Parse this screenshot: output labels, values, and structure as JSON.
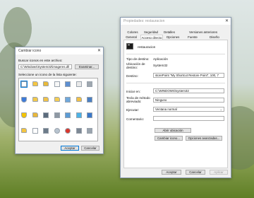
{
  "icon_dialog": {
    "title": "Cambiar icono",
    "search_label": "Buscar iconos en este archivo:",
    "file_path": "C:\\Windows\\System32\\imageres.dll",
    "browse_button": "Examinar...",
    "select_label": "Seleccione un icono de la lista siguiente:",
    "ok_button": "Aceptar",
    "cancel_button": "Cancelar",
    "icons": [
      {
        "name": "blank-page-icon",
        "color": "#ffffff"
      },
      {
        "name": "folder-icon",
        "color": "#f4c542"
      },
      {
        "name": "folder-icon",
        "color": "#e8b93a"
      },
      {
        "name": "document-icon",
        "color": "#f7f7f7"
      },
      {
        "name": "monitor-icon",
        "color": "#5d8fd1"
      },
      {
        "name": "document-icon",
        "color": "#e9e9e9"
      },
      {
        "name": "drive-icon",
        "color": "#a0a8b0"
      },
      {
        "name": "shield-icon",
        "color": "#3d7bd9"
      },
      {
        "name": "folder-icon",
        "color": "#f2c94c"
      },
      {
        "name": "folder-icon",
        "color": "#f0c24a"
      },
      {
        "name": "folder-icon",
        "color": "#f4cd55"
      },
      {
        "name": "image-icon",
        "color": "#6fa8dc"
      },
      {
        "name": "folder-icon",
        "color": "#f0c048"
      },
      {
        "name": "monitor-icon",
        "color": "#4a7fc2"
      },
      {
        "name": "shield-icon",
        "color": "#f5c400"
      },
      {
        "name": "folder-icon",
        "color": "#e9b73a"
      },
      {
        "name": "device-icon",
        "color": "#5b6b7c"
      },
      {
        "name": "drive-icon",
        "color": "#8e98a3"
      },
      {
        "name": "network-drive-icon",
        "color": "#5b9bd5"
      },
      {
        "name": "music-icon",
        "color": "#4db3e6"
      },
      {
        "name": "monitor-icon",
        "color": "#3a78c9"
      },
      {
        "name": "folder-icon",
        "color": "#f4c542"
      },
      {
        "name": "document-icon",
        "color": "#ffffff"
      },
      {
        "name": "device-icon",
        "color": "#6d7b89"
      },
      {
        "name": "disc-icon",
        "color": "#b8c4cf"
      },
      {
        "name": "error-icon",
        "color": "#d9362c"
      },
      {
        "name": "drive-icon",
        "color": "#7d8894"
      },
      {
        "name": "drive-icon",
        "color": "#9aa4ae"
      }
    ]
  },
  "props_dialog": {
    "title": "Propiedades: restauracion",
    "tabs_row1": [
      "Colores",
      "Seguridad",
      "Detalles",
      "Versiones anteriores"
    ],
    "tabs_row2": [
      "General",
      "Acceso directo",
      "Opciones",
      "Fuente",
      "Diseño"
    ],
    "shortcut_name": "restauracion",
    "target_type_label": "Tipo de destino:",
    "target_type_value": "Aplicación",
    "target_location_label": "Ubicación de destino:",
    "target_location_value": "System32",
    "target_label": "Destino:",
    "target_value": "storePoint \"My Shortcut Restore Point\", 100, 7",
    "start_in_label": "Iniciar en:",
    "start_in_value": "C:\\WINDOWS\\system32",
    "hotkey_label": "Tecla de método abreviado:",
    "hotkey_value": "Ninguno",
    "run_label": "Ejecutar:",
    "run_value": "Ventana normal",
    "comment_label": "Comentario:",
    "comment_value": "",
    "open_location_button": "Abrir ubicación",
    "change_icon_button": "Cambiar icono...",
    "advanced_button": "Opciones avanzadas...",
    "ok_button": "Aceptar",
    "cancel_button": "Cancelar",
    "apply_button": "Aplicar"
  }
}
